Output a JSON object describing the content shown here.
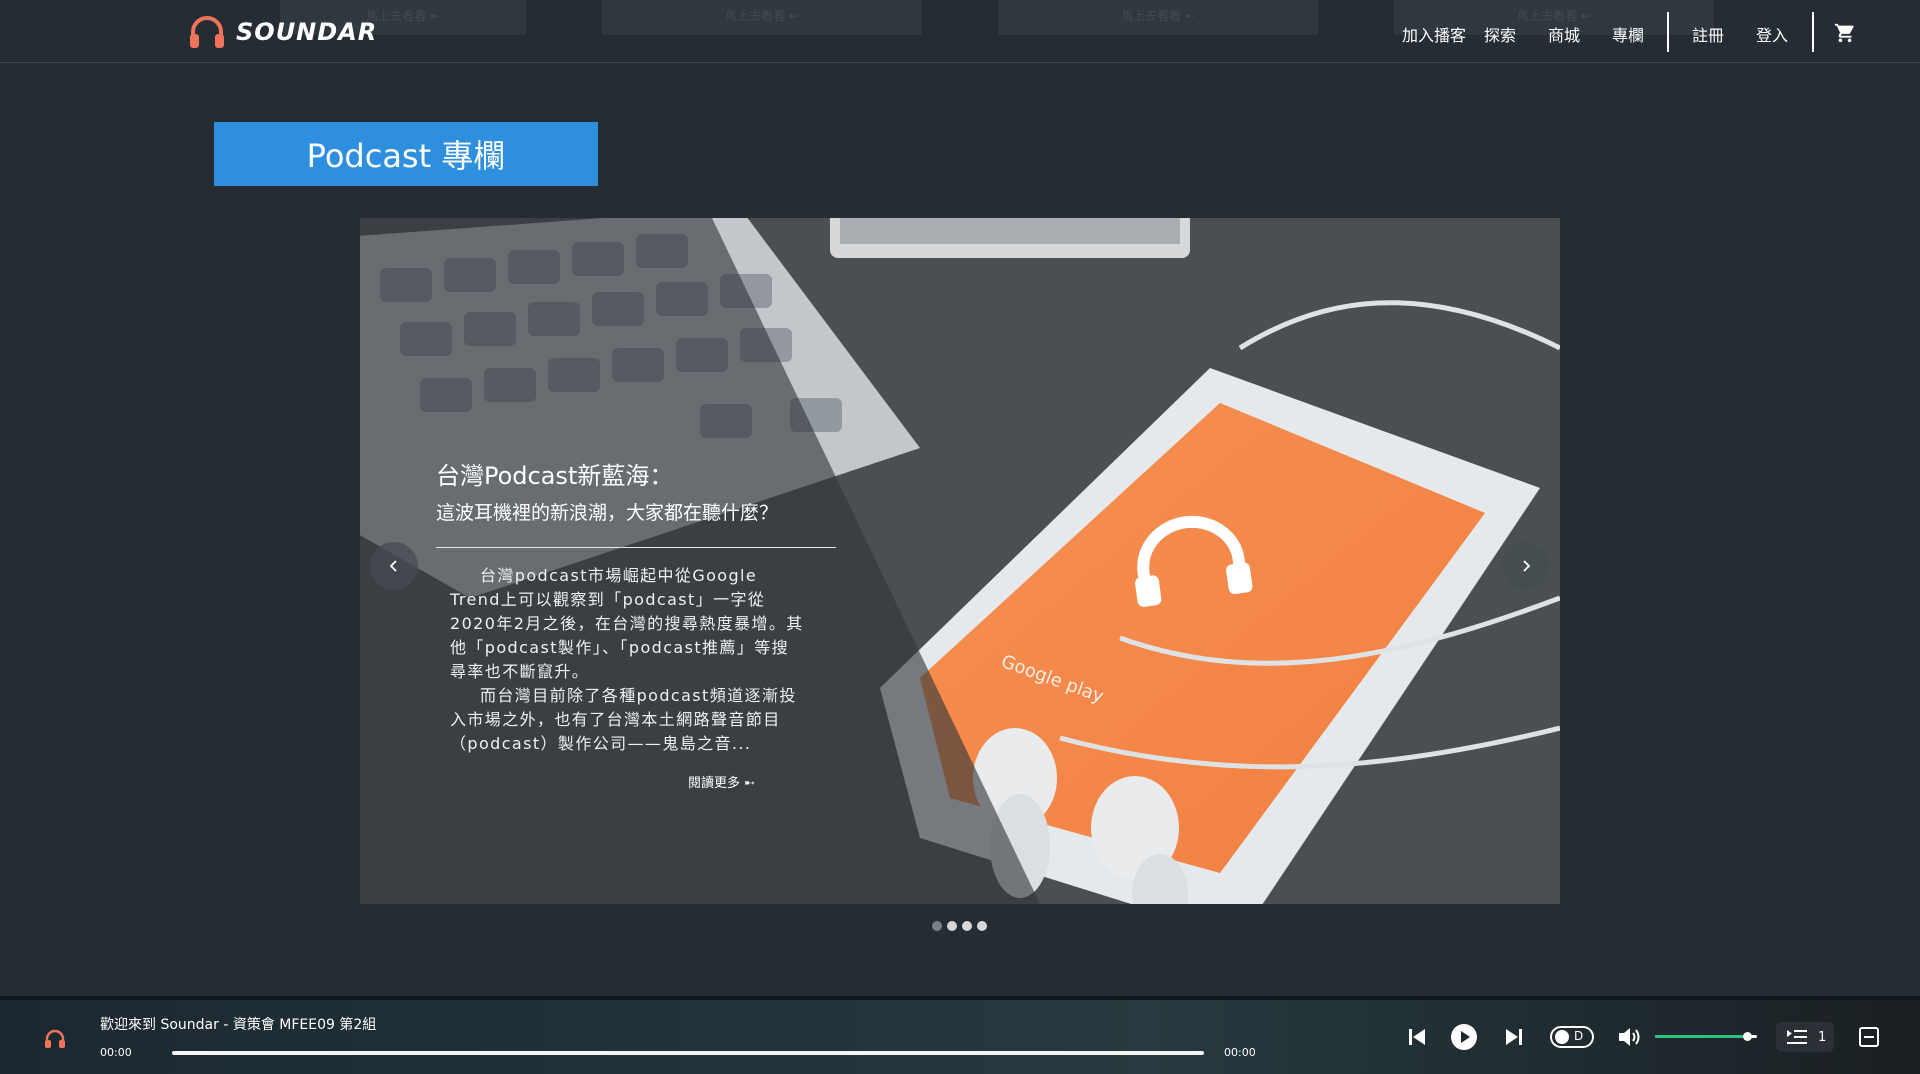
{
  "header": {
    "brand": "SOUNDAR",
    "ghost_label": "馬上去看看 ➸",
    "nav": {
      "join": "加入播客",
      "explore": "探索",
      "shop": "商城",
      "column": "專欄",
      "register": "註冊",
      "login": "登入"
    },
    "icons": {
      "logo": "headphones-icon",
      "cart": "cart-icon"
    }
  },
  "section": {
    "label": "Podcast 專欄"
  },
  "carousel": {
    "title": "台灣Podcast新藍海：",
    "subtitle": "這波耳機裡的新浪潮，大家都在聽什麼？",
    "paragraph1": "台灣podcast市場崛起中從Google Trend上可以觀察到「podcast」一字從2020年2月之後，在台灣的搜尋熱度暴增。其他「podcast製作」、「podcast推薦」等搜尋率也不斷竄升。",
    "paragraph2": "而台灣目前除了各種podcast頻道逐漸投入市場之外，也有了台灣本土網路聲音節目（podcast）製作公司——鬼島之音...",
    "read_more": "閱讀更多 ➸",
    "dots_total": 4,
    "active_dot": 0,
    "prev_icon": "chevron-left-icon",
    "next_icon": "chevron-right-icon"
  },
  "player": {
    "track": "歡迎來到 Soundar - 資策會 MFEE09 第2組",
    "time_current": "00:00",
    "time_total": "00:00",
    "toggle_label": "D",
    "queue_count": "1",
    "progress": 0,
    "volume": 0.9,
    "colors": {
      "volume": "#2ec27e",
      "accent": "#f0735a",
      "section": "#2f8fdf"
    }
  }
}
